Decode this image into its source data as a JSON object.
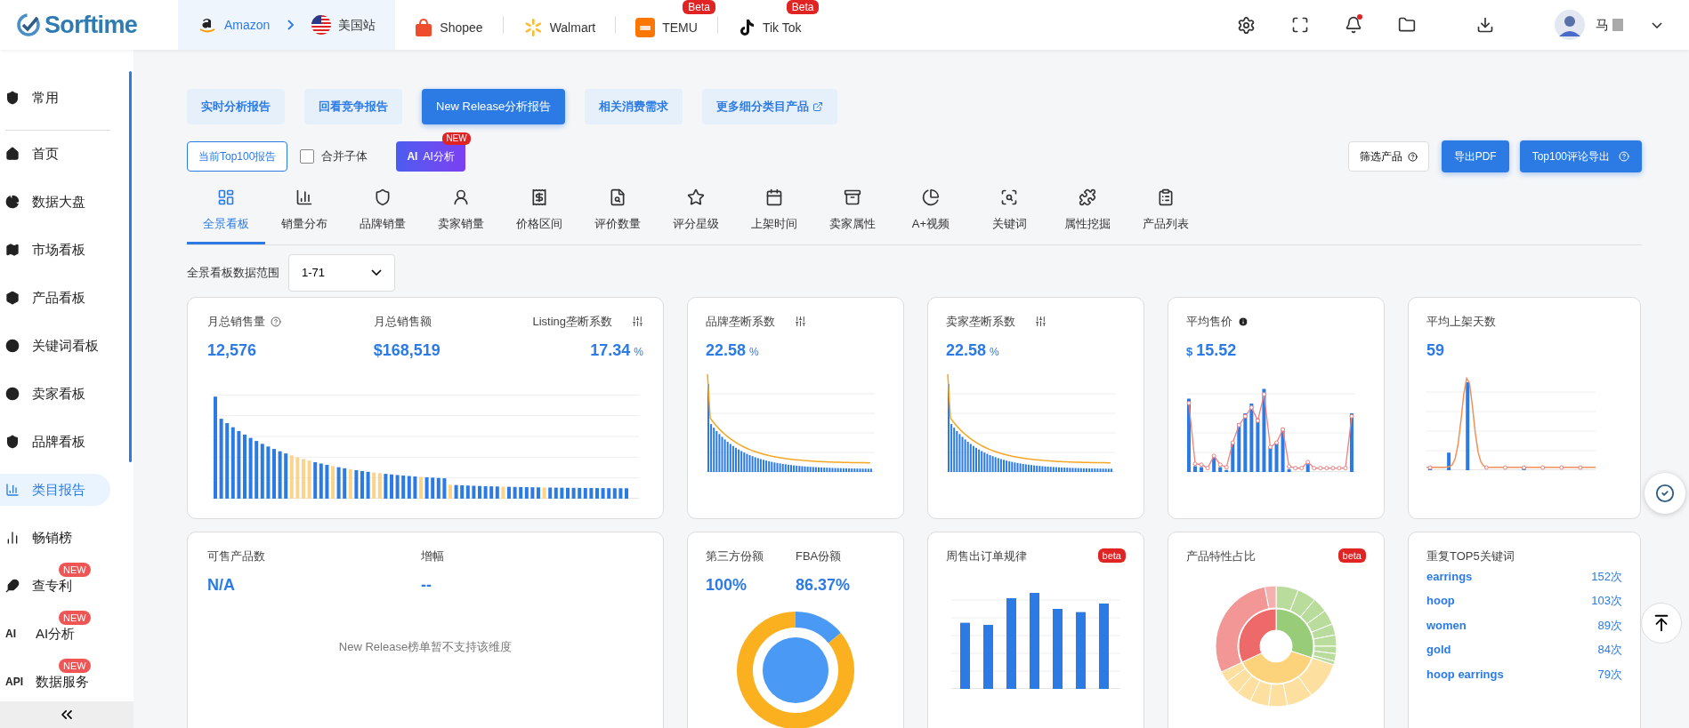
{
  "logo": {
    "text": "Sorftime"
  },
  "markets": [
    {
      "label": "Amazon",
      "site": "美国站",
      "selected": true
    },
    {
      "label": "Shopee",
      "selected": false
    },
    {
      "label": "Walmart",
      "selected": false
    },
    {
      "label": "TEMU",
      "selected": false,
      "badge": "Beta"
    },
    {
      "label": "Tik Tok",
      "selected": false,
      "badge": "Beta"
    }
  ],
  "user": {
    "name": "马"
  },
  "notifications": {
    "unread": true
  },
  "sidebar": [
    {
      "label": "常用",
      "selected": false
    },
    {
      "label": "首页",
      "selected": false
    },
    {
      "label": "数据大盘",
      "selected": false
    },
    {
      "label": "市场看板",
      "selected": false
    },
    {
      "label": "产品看板",
      "selected": false
    },
    {
      "label": "关键词看板",
      "selected": false
    },
    {
      "label": "卖家看板",
      "selected": false
    },
    {
      "label": "品牌看板",
      "selected": false
    },
    {
      "label": "类目报告",
      "selected": true
    },
    {
      "label": "畅销榜",
      "selected": false
    },
    {
      "label": "查专利",
      "selected": false,
      "badge": "NEW"
    },
    {
      "label": "AI分析",
      "selected": false,
      "badge": "NEW",
      "glyph": "AI"
    },
    {
      "label": "数据服务",
      "selected": false,
      "badge": "NEW",
      "glyph": "API"
    }
  ],
  "report_buttons": [
    {
      "label": "实时分析报告",
      "selected": false
    },
    {
      "label": "回看竞争报告",
      "selected": false
    },
    {
      "label": "New Release分析报告",
      "selected": true
    },
    {
      "label": "相关消费需求",
      "selected": false
    },
    {
      "label": "更多细分类目产品",
      "selected": false,
      "external": true
    }
  ],
  "toolbar": {
    "top100": "当前Top100报告",
    "merge": {
      "label": "合并子体",
      "checked": false
    },
    "ai": {
      "glyph": "AI",
      "label": "AI分析",
      "badge": "NEW"
    },
    "filter": "筛选产品",
    "pdf": "导出PDF",
    "reviews": "Top100评论导出"
  },
  "tabs": [
    {
      "label": "全景看板",
      "selected": true
    },
    {
      "label": "销量分布",
      "selected": false
    },
    {
      "label": "品牌销量",
      "selected": false
    },
    {
      "label": "卖家销量",
      "selected": false
    },
    {
      "label": "价格区间",
      "selected": false
    },
    {
      "label": "评价数量",
      "selected": false
    },
    {
      "label": "评分星级",
      "selected": false
    },
    {
      "label": "上架时间",
      "selected": false
    },
    {
      "label": "卖家属性",
      "selected": false
    },
    {
      "label": "A+视频",
      "selected": false
    },
    {
      "label": "关键词",
      "selected": false
    },
    {
      "label": "属性挖掘",
      "selected": false
    },
    {
      "label": "产品列表",
      "selected": false
    }
  ],
  "range": {
    "label": "全景看板数据范围",
    "value": "1-71"
  },
  "cards": [
    {
      "kind": "longtail",
      "metrics": [
        {
          "label": "月总销售量",
          "value": "12,576",
          "kind": "help"
        },
        {
          "label": "月总销售额",
          "value": "$168,519",
          "kind": "plain"
        },
        {
          "label": "Listing垄断系数",
          "value": "17.34",
          "unit": "%",
          "kind": "gauge"
        }
      ]
    },
    {
      "kind": "trend",
      "metrics": [
        {
          "label": "品牌垄断系数",
          "value": "22.58",
          "unit": "%",
          "kind": "gauge"
        }
      ]
    },
    {
      "kind": "trend",
      "metrics": [
        {
          "label": "卖家垄断系数",
          "value": "22.58",
          "unit": "%",
          "kind": "gauge"
        }
      ]
    },
    {
      "kind": "price",
      "metrics": [
        {
          "label": "平均售价",
          "value": "15.52",
          "prefix": "$",
          "kind": "info"
        }
      ]
    },
    {
      "kind": "spike",
      "metrics": [
        {
          "label": "平均上架天数",
          "value": "59",
          "kind": "plain"
        }
      ]
    },
    {
      "kind": "empty",
      "metrics": [
        {
          "label": "可售产品数",
          "value": "N/A",
          "kind": "plain"
        },
        {
          "label": "增幅",
          "value": "--",
          "kind": "plain"
        }
      ],
      "message": "New Release榜单暂不支持该维度"
    },
    {
      "kind": "donut",
      "metrics": [
        {
          "label": "第三方份额",
          "value": "100%",
          "kind": "plain"
        },
        {
          "label": "FBA份额",
          "value": "86.37%",
          "kind": "plain"
        }
      ]
    },
    {
      "kind": "weekly",
      "metrics": [
        {
          "label": "周售出订单规律",
          "kind": "plain"
        }
      ],
      "badge": "beta"
    },
    {
      "kind": "sunburst",
      "metrics": [
        {
          "label": "产品特性占比",
          "kind": "plain"
        }
      ],
      "badge": "beta"
    },
    {
      "kind": "keywords",
      "metrics": [
        {
          "label": "重复TOP5关键词",
          "kind": "plain"
        }
      ],
      "keywords": [
        {
          "word": "earrings",
          "count": "152次"
        },
        {
          "word": "hoop",
          "count": "103次"
        },
        {
          "word": "women",
          "count": "89次"
        },
        {
          "word": "gold",
          "count": "84次"
        },
        {
          "word": "hoop earrings",
          "count": "79次"
        }
      ]
    }
  ]
}
